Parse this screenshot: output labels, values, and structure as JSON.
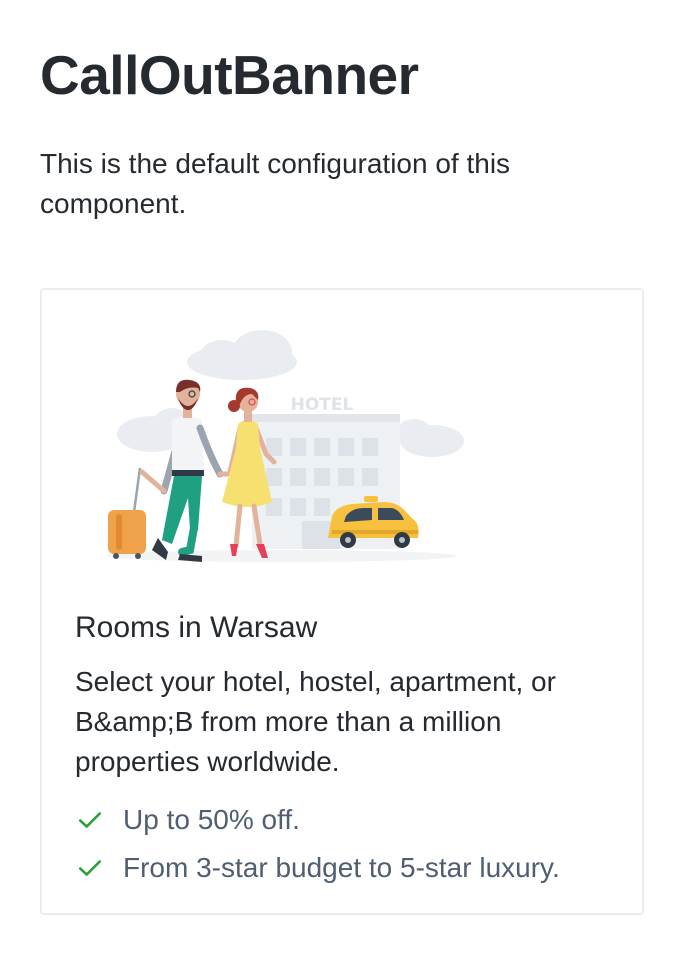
{
  "page": {
    "title": "CallOutBanner",
    "description": "This is the default configuration of this component."
  },
  "banner": {
    "illustration": {
      "name": "hotel-couple-taxi-illustration",
      "sign_text": "HOTEL"
    },
    "title": "Rooms in Warsaw",
    "description": "Select your hotel, hostel, apartment, or B&amp;B from more than a million properties worldwide.",
    "features": [
      {
        "icon": "check-icon",
        "text": "Up to 50% off."
      },
      {
        "icon": "check-icon",
        "text": "From 3-star budget to 5-star luxury."
      }
    ]
  },
  "colors": {
    "text_primary": "#252a31",
    "text_secondary": "#4f5e71",
    "check_green": "#28a138",
    "border": "#e8edf1",
    "taxi_yellow": "#f7c13f"
  }
}
